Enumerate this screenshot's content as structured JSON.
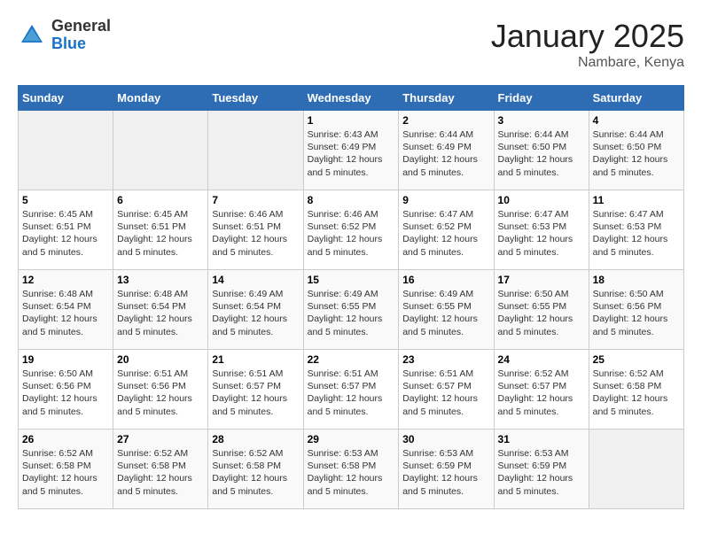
{
  "header": {
    "logo_general": "General",
    "logo_blue": "Blue",
    "title": "January 2025",
    "subtitle": "Nambare, Kenya"
  },
  "calendar": {
    "days_of_week": [
      "Sunday",
      "Monday",
      "Tuesday",
      "Wednesday",
      "Thursday",
      "Friday",
      "Saturday"
    ],
    "weeks": [
      [
        {
          "day": "",
          "info": ""
        },
        {
          "day": "",
          "info": ""
        },
        {
          "day": "",
          "info": ""
        },
        {
          "day": "1",
          "info": "Sunrise: 6:43 AM\nSunset: 6:49 PM\nDaylight: 12 hours and 5 minutes."
        },
        {
          "day": "2",
          "info": "Sunrise: 6:44 AM\nSunset: 6:49 PM\nDaylight: 12 hours and 5 minutes."
        },
        {
          "day": "3",
          "info": "Sunrise: 6:44 AM\nSunset: 6:50 PM\nDaylight: 12 hours and 5 minutes."
        },
        {
          "day": "4",
          "info": "Sunrise: 6:44 AM\nSunset: 6:50 PM\nDaylight: 12 hours and 5 minutes."
        }
      ],
      [
        {
          "day": "5",
          "info": "Sunrise: 6:45 AM\nSunset: 6:51 PM\nDaylight: 12 hours and 5 minutes."
        },
        {
          "day": "6",
          "info": "Sunrise: 6:45 AM\nSunset: 6:51 PM\nDaylight: 12 hours and 5 minutes."
        },
        {
          "day": "7",
          "info": "Sunrise: 6:46 AM\nSunset: 6:51 PM\nDaylight: 12 hours and 5 minutes."
        },
        {
          "day": "8",
          "info": "Sunrise: 6:46 AM\nSunset: 6:52 PM\nDaylight: 12 hours and 5 minutes."
        },
        {
          "day": "9",
          "info": "Sunrise: 6:47 AM\nSunset: 6:52 PM\nDaylight: 12 hours and 5 minutes."
        },
        {
          "day": "10",
          "info": "Sunrise: 6:47 AM\nSunset: 6:53 PM\nDaylight: 12 hours and 5 minutes."
        },
        {
          "day": "11",
          "info": "Sunrise: 6:47 AM\nSunset: 6:53 PM\nDaylight: 12 hours and 5 minutes."
        }
      ],
      [
        {
          "day": "12",
          "info": "Sunrise: 6:48 AM\nSunset: 6:54 PM\nDaylight: 12 hours and 5 minutes."
        },
        {
          "day": "13",
          "info": "Sunrise: 6:48 AM\nSunset: 6:54 PM\nDaylight: 12 hours and 5 minutes."
        },
        {
          "day": "14",
          "info": "Sunrise: 6:49 AM\nSunset: 6:54 PM\nDaylight: 12 hours and 5 minutes."
        },
        {
          "day": "15",
          "info": "Sunrise: 6:49 AM\nSunset: 6:55 PM\nDaylight: 12 hours and 5 minutes."
        },
        {
          "day": "16",
          "info": "Sunrise: 6:49 AM\nSunset: 6:55 PM\nDaylight: 12 hours and 5 minutes."
        },
        {
          "day": "17",
          "info": "Sunrise: 6:50 AM\nSunset: 6:55 PM\nDaylight: 12 hours and 5 minutes."
        },
        {
          "day": "18",
          "info": "Sunrise: 6:50 AM\nSunset: 6:56 PM\nDaylight: 12 hours and 5 minutes."
        }
      ],
      [
        {
          "day": "19",
          "info": "Sunrise: 6:50 AM\nSunset: 6:56 PM\nDaylight: 12 hours and 5 minutes."
        },
        {
          "day": "20",
          "info": "Sunrise: 6:51 AM\nSunset: 6:56 PM\nDaylight: 12 hours and 5 minutes."
        },
        {
          "day": "21",
          "info": "Sunrise: 6:51 AM\nSunset: 6:57 PM\nDaylight: 12 hours and 5 minutes."
        },
        {
          "day": "22",
          "info": "Sunrise: 6:51 AM\nSunset: 6:57 PM\nDaylight: 12 hours and 5 minutes."
        },
        {
          "day": "23",
          "info": "Sunrise: 6:51 AM\nSunset: 6:57 PM\nDaylight: 12 hours and 5 minutes."
        },
        {
          "day": "24",
          "info": "Sunrise: 6:52 AM\nSunset: 6:57 PM\nDaylight: 12 hours and 5 minutes."
        },
        {
          "day": "25",
          "info": "Sunrise: 6:52 AM\nSunset: 6:58 PM\nDaylight: 12 hours and 5 minutes."
        }
      ],
      [
        {
          "day": "26",
          "info": "Sunrise: 6:52 AM\nSunset: 6:58 PM\nDaylight: 12 hours and 5 minutes."
        },
        {
          "day": "27",
          "info": "Sunrise: 6:52 AM\nSunset: 6:58 PM\nDaylight: 12 hours and 5 minutes."
        },
        {
          "day": "28",
          "info": "Sunrise: 6:52 AM\nSunset: 6:58 PM\nDaylight: 12 hours and 5 minutes."
        },
        {
          "day": "29",
          "info": "Sunrise: 6:53 AM\nSunset: 6:58 PM\nDaylight: 12 hours and 5 minutes."
        },
        {
          "day": "30",
          "info": "Sunrise: 6:53 AM\nSunset: 6:59 PM\nDaylight: 12 hours and 5 minutes."
        },
        {
          "day": "31",
          "info": "Sunrise: 6:53 AM\nSunset: 6:59 PM\nDaylight: 12 hours and 5 minutes."
        },
        {
          "day": "",
          "info": ""
        }
      ]
    ]
  }
}
